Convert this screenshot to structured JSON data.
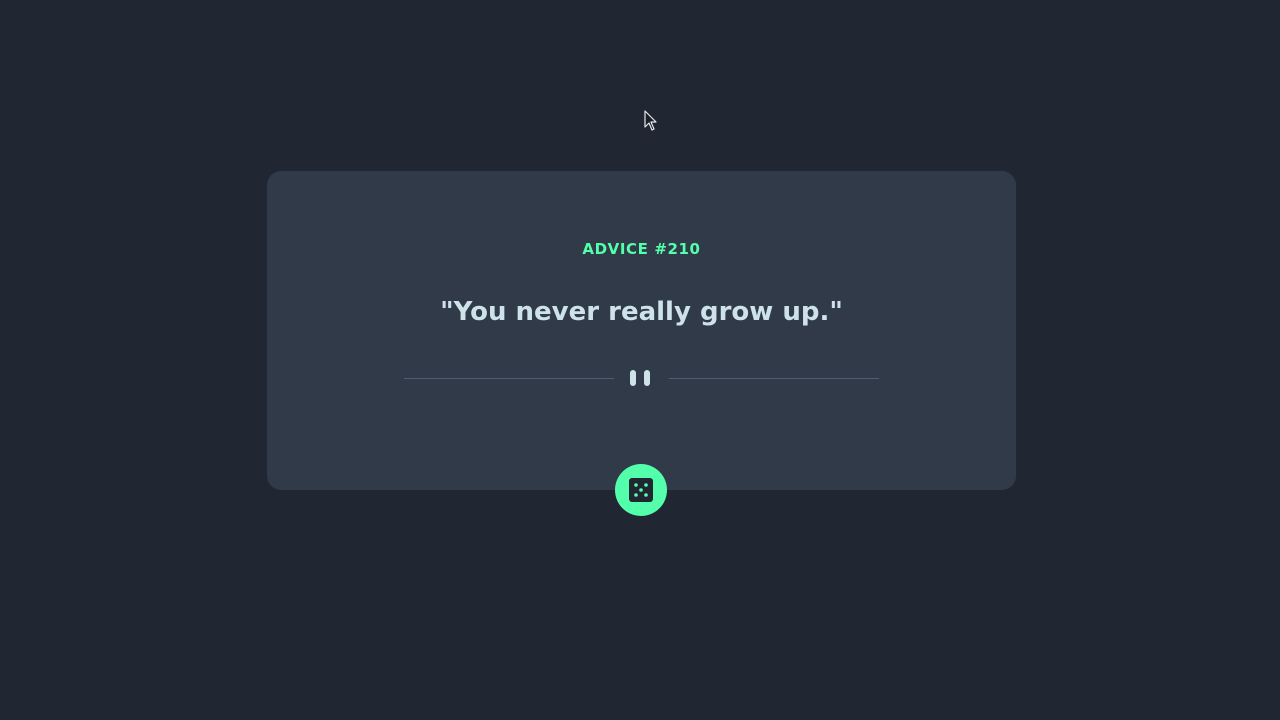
{
  "advice": {
    "id_label": "ADVICE #210",
    "text": "\"You never really grow up.\""
  },
  "dice_button": {
    "icon": "dice-icon"
  },
  "colors": {
    "background": "#202632",
    "card": "#313a48",
    "accent": "#53ffab",
    "text": "#cee3e9",
    "divider": "#4f5d74"
  }
}
